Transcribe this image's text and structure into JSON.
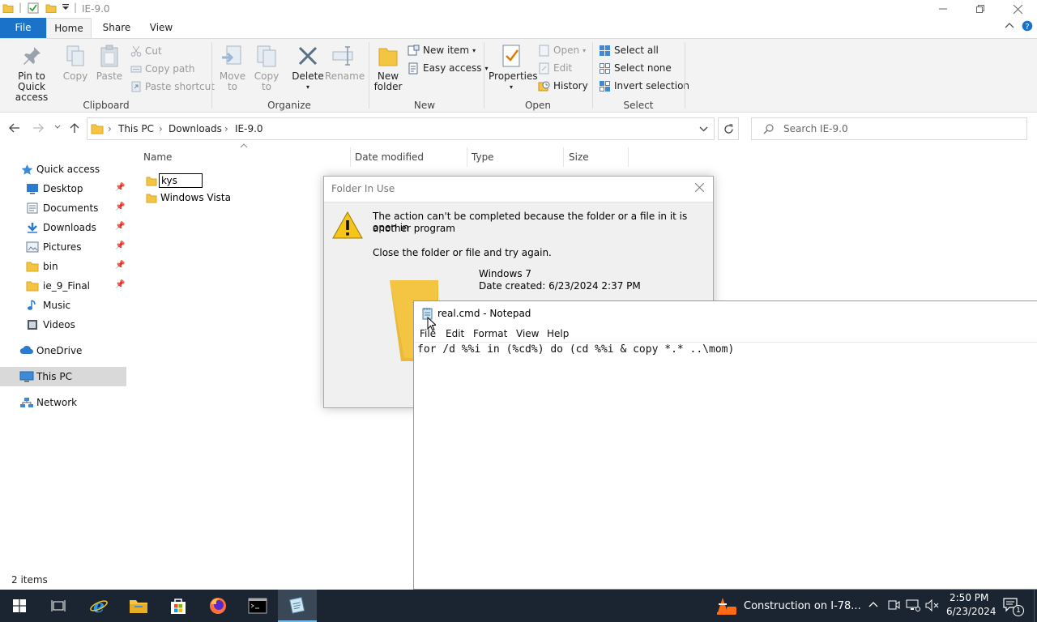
{
  "window": {
    "title": "IE-9.0"
  },
  "ribbon_tabs": [
    "File",
    "Home",
    "Share",
    "View"
  ],
  "ribbon": {
    "clipboard": {
      "pin_label_1": "Pin to Quick",
      "pin_label_2": "access",
      "copy": "Copy",
      "paste": "Paste",
      "cut": "Cut",
      "copy_path": "Copy path",
      "paste_shortcut": "Paste shortcut",
      "group": "Clipboard"
    },
    "organize": {
      "move_to_1": "Move",
      "move_to_2": "to",
      "copy_to_1": "Copy",
      "copy_to_2": "to",
      "delete": "Delete",
      "rename": "Rename",
      "group": "Organize"
    },
    "new": {
      "new_folder_1": "New",
      "new_folder_2": "folder",
      "new_item": "New item",
      "easy_access": "Easy access",
      "group": "New"
    },
    "open": {
      "properties": "Properties",
      "open": "Open",
      "edit": "Edit",
      "history": "History",
      "group": "Open"
    },
    "select": {
      "select_all": "Select all",
      "select_none": "Select none",
      "invert_selection": "Invert selection",
      "group": "Select"
    }
  },
  "address": {
    "breadcrumbs": [
      "This PC",
      "Downloads",
      "IE-9.0"
    ],
    "search_placeholder": "Search IE-9.0"
  },
  "nav_pane": {
    "quick_access": "Quick access",
    "items": [
      "Desktop",
      "Documents",
      "Downloads",
      "Pictures",
      "bin",
      "ie_9_Final",
      "Music",
      "Videos"
    ],
    "onedrive": "OneDrive",
    "this_pc": "This PC",
    "network": "Network"
  },
  "file_list": {
    "columns": [
      "Name",
      "Date modified",
      "Type",
      "Size"
    ],
    "rename_value": "kys",
    "rows": [
      "Windows Vista"
    ]
  },
  "status": {
    "item_count": "2 items"
  },
  "dialog": {
    "title": "Folder In Use",
    "message_1": "The action can't be completed because the folder or a file in it is open in",
    "message_2": "another program",
    "instruction": "Close the folder or file and try again.",
    "item_name": "Windows 7",
    "item_date": "Date created: 6/23/2024 2:37 PM"
  },
  "notepad": {
    "title": "real.cmd - Notepad",
    "menu": [
      "File",
      "Edit",
      "Format",
      "View",
      "Help"
    ],
    "content": "for /d %%i in (%cd%) do (cd %%i & copy *.* ..\\mom)"
  },
  "taskbar": {
    "notification": "Construction on I-78...",
    "time": "2:50 PM",
    "date": "6/23/2024",
    "action_center_count": "1"
  },
  "colors": {
    "file_tab": "#1a73c8",
    "folder": "#f4c542",
    "taskbar": "#1b2531",
    "selection": "#d9d9d9"
  }
}
